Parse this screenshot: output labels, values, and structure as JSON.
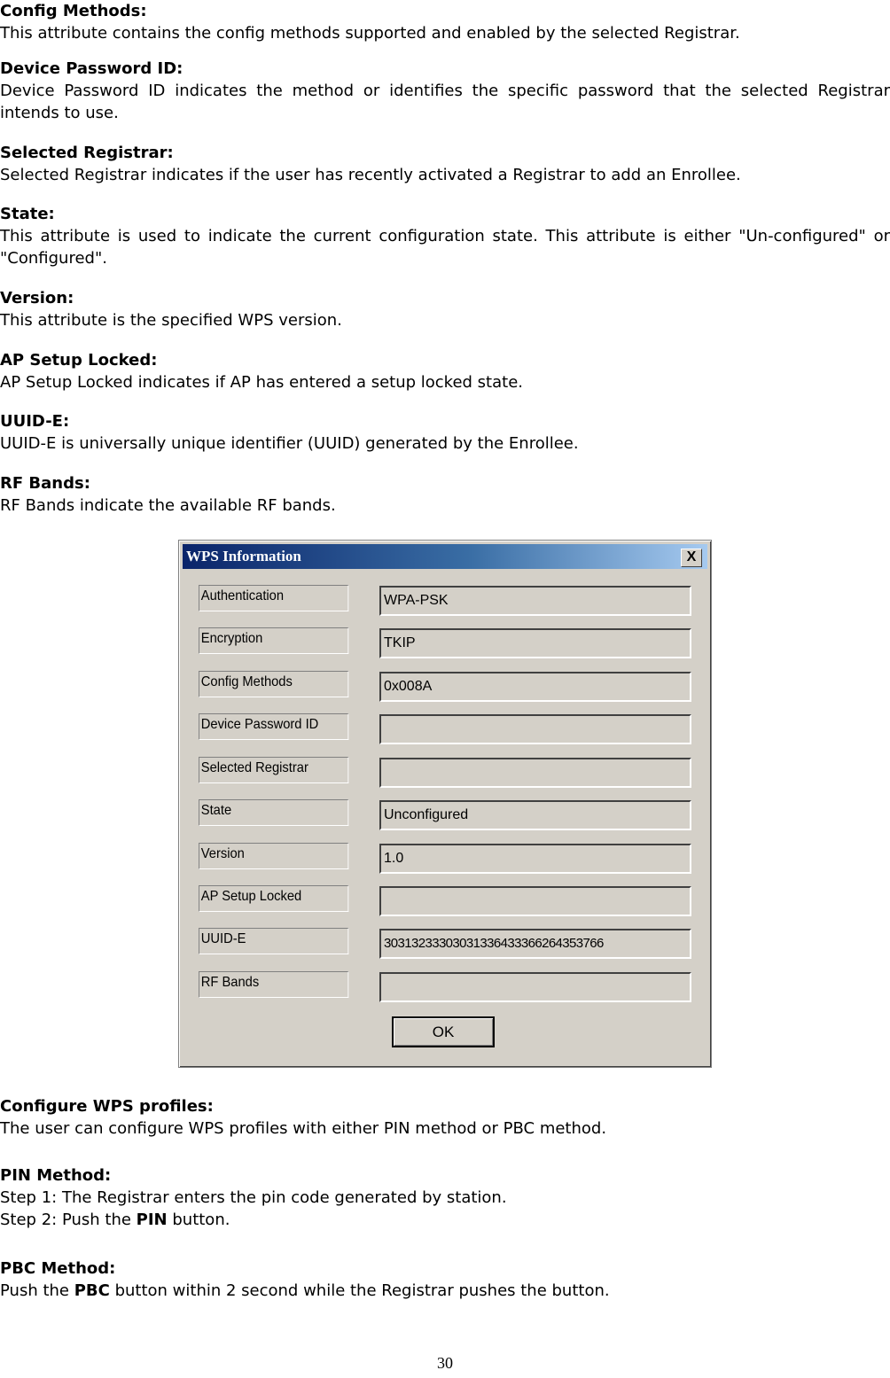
{
  "sections_top": [
    {
      "heading": "Config Methods:",
      "body": "This attribute contains the config methods supported and enabled by the selected Registrar."
    },
    {
      "heading": "Device Password ID:",
      "body": "Device Password ID indicates the method or identifies the specific password that the selected Registrar intends to use."
    },
    {
      "heading": "Selected Registrar:",
      "body": "Selected Registrar indicates if the user has recently activated a Registrar to add an Enrollee."
    },
    {
      "heading": "State:",
      "body": "This attribute is used to indicate the current configuration state. This attribute is either \"Un-configured\" or \"Configured\"."
    },
    {
      "heading": "Version:",
      "body": "This attribute is the specified WPS version."
    },
    {
      "heading": "AP Setup Locked:",
      "body": "AP Setup Locked indicates if AP has entered a setup locked state."
    },
    {
      "heading": "UUID-E:",
      "body": "UUID-E is universally unique identifier (UUID) generated by the Enrollee."
    },
    {
      "heading": "RF Bands:",
      "body": "RF Bands indicate the available RF bands."
    }
  ],
  "dialog": {
    "title": "WPS Information",
    "close_label": "X",
    "fields": [
      {
        "label": "Authentication",
        "value": "WPA-PSK"
      },
      {
        "label": "Encryption",
        "value": "TKIP"
      },
      {
        "label": "Config Methods",
        "value": "0x008A"
      },
      {
        "label": "Device Password ID",
        "value": ""
      },
      {
        "label": "Selected Registrar",
        "value": ""
      },
      {
        "label": "State",
        "value": "Unconfigured"
      },
      {
        "label": "Version",
        "value": "1.0"
      },
      {
        "label": "AP Setup Locked",
        "value": ""
      },
      {
        "label": "UUID-E",
        "value": "30313233303031336433366264353766"
      },
      {
        "label": "RF Bands",
        "value": ""
      }
    ],
    "ok_label": "OK"
  },
  "sections_bottom": {
    "configure": {
      "heading": "Configure WPS profiles:",
      "body": "The user can configure WPS profiles with either PIN method or PBC method."
    },
    "pin": {
      "heading": "PIN Method:",
      "step1": "Step 1: The Registrar enters the pin code generated by station.",
      "step2_pre": "Step 2: Push the ",
      "step2_bold": "PIN",
      "step2_post": " button."
    },
    "pbc": {
      "heading": "PBC Method:",
      "pre": "Push the ",
      "bold": "PBC",
      "post": " button within 2 second while the Registrar pushes the button."
    }
  },
  "page_number": "30"
}
